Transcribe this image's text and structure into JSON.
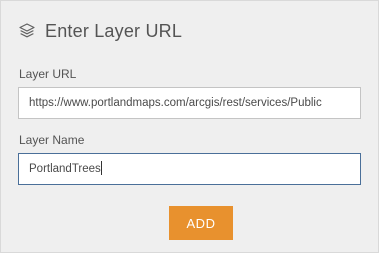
{
  "header": {
    "icon": "layers-icon",
    "title": "Enter Layer URL"
  },
  "form": {
    "url_label": "Layer URL",
    "url_value": "https://www.portlandmaps.com/arcgis/rest/services/Public",
    "name_label": "Layer Name",
    "name_value": "PortlandTrees"
  },
  "actions": {
    "add_label": "ADD"
  },
  "colors": {
    "panel_bg": "#efefef",
    "accent": "#e8912e",
    "focus_border": "#4a6f99",
    "text": "#545454"
  }
}
